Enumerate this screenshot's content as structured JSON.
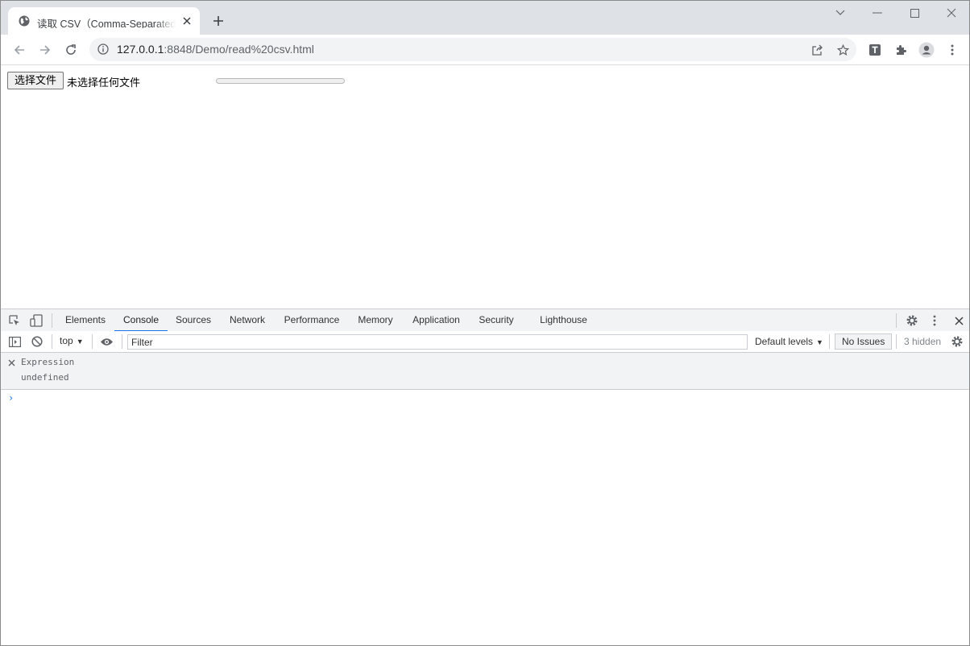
{
  "browser": {
    "tab": {
      "title": "读取 CSV（Comma-Separated Values）",
      "favicon": "globe-icon",
      "close_icon": "close-icon"
    },
    "new_tab_icon": "plus-icon",
    "window_controls": [
      "chevron-down-icon",
      "minimize-icon",
      "maximize-icon",
      "close-icon"
    ],
    "toolbar": {
      "back_icon": "arrow-left-icon",
      "forward_icon": "arrow-right-icon",
      "reload_icon": "reload-icon",
      "site_info_icon": "info-icon",
      "url_host": "127.0.0.1",
      "url_rest": ":8848/Demo/read%20csv.html",
      "share_icon": "share-icon",
      "bookmark_icon": "star-icon",
      "extensions": [
        "T",
        "puzzle-icon",
        "profile-icon",
        "menu-dots-icon"
      ]
    }
  },
  "page": {
    "file_button_label": "选择文件",
    "file_status": "未选择任何文件",
    "progress_value": 0
  },
  "devtools": {
    "tabs": [
      "Elements",
      "Console",
      "Sources",
      "Network",
      "Performance",
      "Memory",
      "Application",
      "Security",
      "Lighthouse"
    ],
    "active_tab": "Console",
    "console": {
      "context": "top",
      "filter_placeholder": "Filter",
      "levels": "Default levels",
      "issues": "No Issues",
      "hidden": "3 hidden",
      "expression_label": "Expression",
      "expression_value": "undefined",
      "prompt": "›"
    },
    "accent_color": "#1a73e8"
  }
}
